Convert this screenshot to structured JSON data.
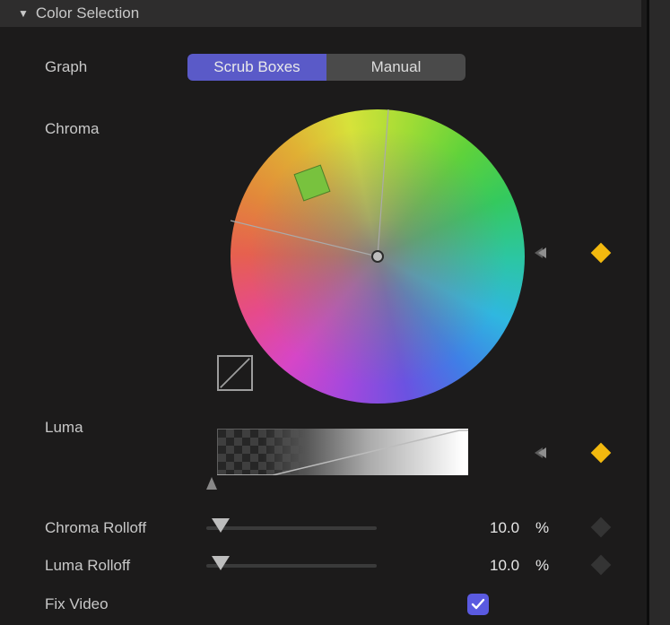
{
  "section": {
    "title": "Color Selection"
  },
  "labels": {
    "graph": "Graph",
    "chroma": "Chroma",
    "luma": "Luma",
    "chroma_rolloff": "Chroma Rolloff",
    "luma_rolloff": "Luma Rolloff",
    "fix_video": "Fix Video"
  },
  "graph_mode": {
    "options": [
      "Scrub Boxes",
      "Manual"
    ],
    "selected": "Scrub Boxes"
  },
  "chroma_rolloff": {
    "value": "10.0",
    "unit": "%"
  },
  "luma_rolloff": {
    "value": "10.0",
    "unit": "%"
  },
  "fix_video": {
    "checked": true
  },
  "icons": {
    "reset": "reset-arrow-icon",
    "keyframe": "keyframe-diamond-icon",
    "disclosure": "disclosure-triangle-icon",
    "curve": "curve-icon",
    "checkmark": "checkmark-icon"
  },
  "colors": {
    "accent": "#5a5ae0",
    "keyframe_active": "#f2b90f"
  }
}
